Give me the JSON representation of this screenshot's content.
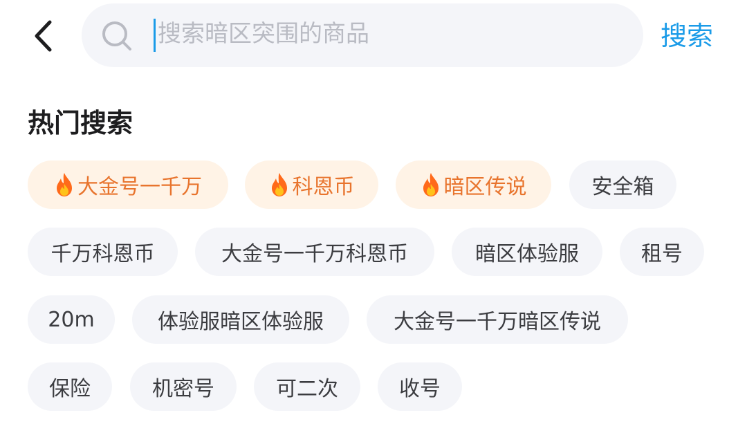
{
  "header": {
    "search_placeholder": "搜索暗区突围的商品",
    "search_button_label": "搜索"
  },
  "hot_search": {
    "title": "热门搜索",
    "tags": [
      {
        "label": "大金号一千万",
        "hot": true
      },
      {
        "label": "科恩币",
        "hot": true
      },
      {
        "label": "暗区传说",
        "hot": true
      },
      {
        "label": "安全箱",
        "hot": false
      },
      {
        "label": "千万科恩币",
        "hot": false
      },
      {
        "label": "大金号一千万科恩币",
        "hot": false
      },
      {
        "label": "暗区体验服",
        "hot": false
      },
      {
        "label": "租号",
        "hot": false
      },
      {
        "label": "20m",
        "hot": false
      },
      {
        "label": "体验服暗区体验服",
        "hot": false
      },
      {
        "label": "大金号一千万暗区传说",
        "hot": false
      },
      {
        "label": "保险",
        "hot": false
      },
      {
        "label": "机密号",
        "hot": false
      },
      {
        "label": "可二次",
        "hot": false
      },
      {
        "label": "收号",
        "hot": false
      }
    ]
  },
  "colors": {
    "accent": "#1a9be8",
    "hot_tag_bg": "#fff3e6",
    "hot_tag_text": "#e8742d",
    "tag_bg": "#f4f5f9"
  },
  "icons": {
    "back": "chevron-left-icon",
    "search": "search-icon",
    "hot": "fire-icon"
  }
}
